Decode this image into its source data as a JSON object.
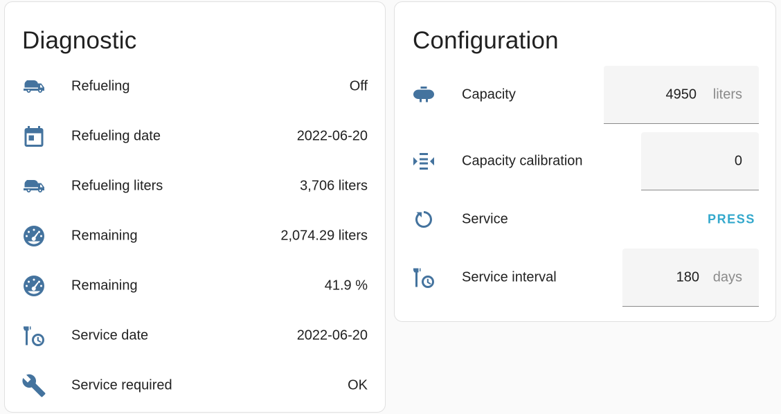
{
  "diagnostic": {
    "title": "Diagnostic",
    "rows": [
      {
        "icon": "tanker-truck-icon",
        "label": "Refueling",
        "value": "Off"
      },
      {
        "icon": "calendar-icon",
        "label": "Refueling date",
        "value": "2022-06-20"
      },
      {
        "icon": "tanker-truck-icon",
        "label": "Refueling liters",
        "value": "3,706 liters"
      },
      {
        "icon": "gauge-icon",
        "label": "Remaining",
        "value": "2,074.29 liters"
      },
      {
        "icon": "gauge-icon",
        "label": "Remaining",
        "value": "41.9 %"
      },
      {
        "icon": "wrench-clock-icon",
        "label": "Service date",
        "value": "2022-06-20"
      },
      {
        "icon": "wrench-icon",
        "label": "Service required",
        "value": "OK"
      }
    ]
  },
  "configuration": {
    "title": "Configuration",
    "capacity": {
      "icon": "propane-tank-icon",
      "label": "Capacity",
      "value": "4950",
      "unit": "liters"
    },
    "calibration": {
      "icon": "arrow-collapse-vertical-icon",
      "label": "Capacity calibration",
      "value": "0"
    },
    "service": {
      "icon": "restart-icon",
      "label": "Service",
      "button": "PRESS"
    },
    "interval": {
      "icon": "wrench-clock-icon",
      "label": "Service interval",
      "value": "180",
      "unit": "days"
    }
  },
  "colors": {
    "icon": "#44739e",
    "accent": "#33a8cc"
  }
}
